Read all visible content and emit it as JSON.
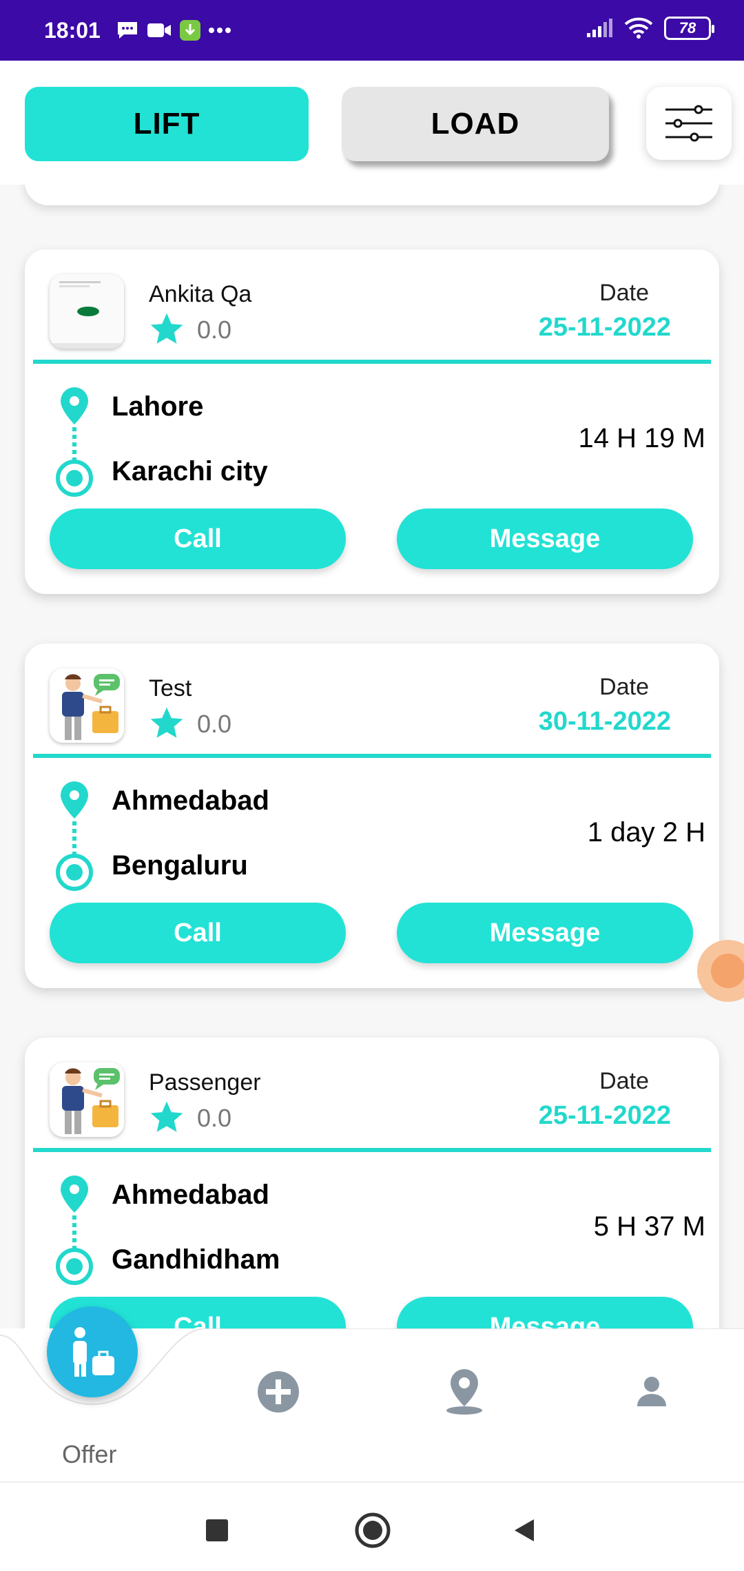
{
  "status_bar": {
    "time": "18:01",
    "battery": "78"
  },
  "top": {
    "lift_label": "LIFT",
    "load_label": "LOAD"
  },
  "cards": [
    {
      "name": "Ankita Qa",
      "rating": "0.0",
      "date_label": "Date",
      "date": "25-11-2022",
      "from": "Lahore",
      "to": "Karachi city",
      "duration": "14 H 19 M",
      "call": "Call",
      "message": "Message"
    },
    {
      "name": "Test",
      "rating": "0.0",
      "date_label": "Date",
      "date": "30-11-2022",
      "from": "Ahmedabad",
      "to": "Bengaluru",
      "duration": "1 day 2 H",
      "call": "Call",
      "message": "Message"
    },
    {
      "name": "Passenger",
      "rating": "0.0",
      "date_label": "Date",
      "date": "25-11-2022",
      "from": "Ahmedabad",
      "to": "Gandhidham",
      "duration": "5 H 37 M",
      "call": "Call",
      "message": "Message"
    }
  ],
  "bottom_nav": {
    "active_label": "Offer",
    "items": [
      "offer-icon",
      "add-icon",
      "location-icon",
      "profile-icon"
    ]
  },
  "colors": {
    "status_bar": "#3c0aa6",
    "accent": "#22e2d5",
    "accent_text": "#22d8cc",
    "fab": "#22b8e2"
  }
}
